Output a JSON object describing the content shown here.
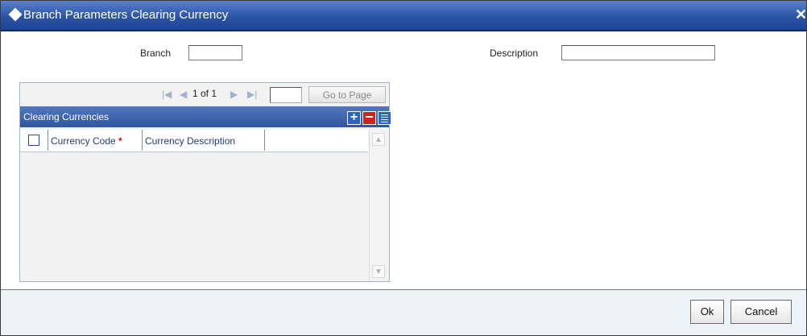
{
  "window": {
    "title": "Branch Parameters Clearing Currency",
    "close_glyph": "✕"
  },
  "form": {
    "branch_label": "Branch",
    "branch_value": "",
    "description_label": "Description",
    "description_value": ""
  },
  "pager": {
    "text": "1 of 1",
    "page_value": "",
    "goto_label": "Go to Page"
  },
  "grid": {
    "title": "Clearing Currencies",
    "columns": [
      {
        "label": "Currency Code",
        "required_mark": "*"
      },
      {
        "label": "Currency Description"
      }
    ],
    "rows": []
  },
  "footer": {
    "ok_label": "Ok",
    "cancel_label": "Cancel"
  },
  "colors": {
    "titlebar": "#2b54a6",
    "grid_header": "#2e559f",
    "required": "#d11111",
    "delete_button": "#d62020"
  }
}
